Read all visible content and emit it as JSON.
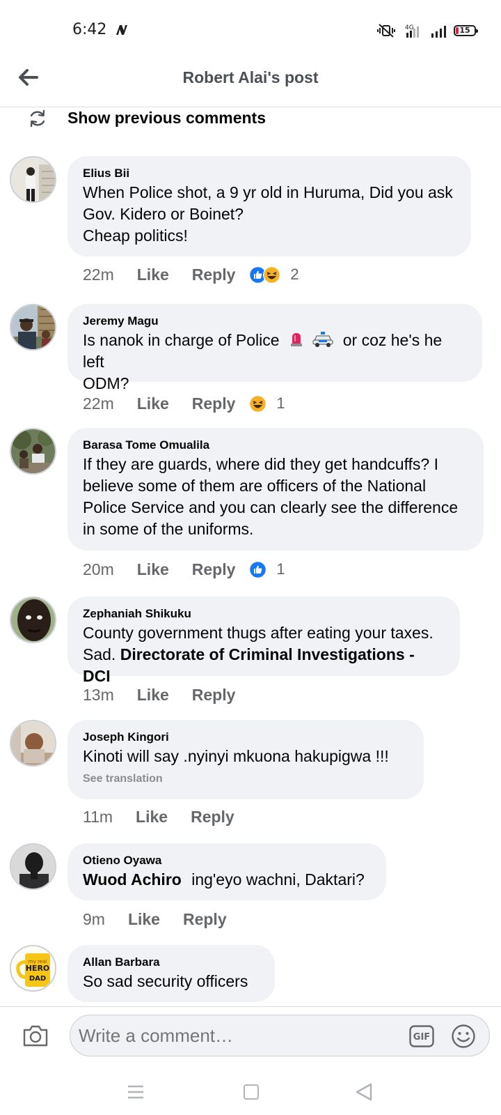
{
  "status_bar": {
    "time": "6:42",
    "battery": "15",
    "network": "4G"
  },
  "header": {
    "title": "Robert Alai's post"
  },
  "previous_comments": {
    "label": "Show previous comments"
  },
  "comments": [
    {
      "author": "Elius Bii",
      "lines": [
        "When Police shot, a 9 yr old in Huruma, Did you ask",
        "Gov. Kidero or Boinet?",
        "Cheap politics!"
      ],
      "time": "22m",
      "like": "Like",
      "reply": "Reply",
      "reactions": [
        "like",
        "haha"
      ],
      "reaction_count": "2"
    },
    {
      "author": "Jeremy Magu",
      "lines": [
        "Is nanok in charge of Police",
        "or coz he's he left",
        "ODM?"
      ],
      "emoji_in_text": [
        "police-light",
        "police-car"
      ],
      "time": "22m",
      "like": "Like",
      "reply": "Reply",
      "reactions": [
        "haha"
      ],
      "reaction_count": "1"
    },
    {
      "author": "Barasa Tome Omualila",
      "lines": [
        "If they are guards, where did they get handcuffs? I",
        "believe some of them are officers of the National",
        "Police Service and you can clearly see the difference",
        "in some of the uniforms."
      ],
      "time": "20m",
      "like": "Like",
      "reply": "Reply",
      "reactions": [
        "like"
      ],
      "reaction_count": "1"
    },
    {
      "author": "Zephaniah Shikuku",
      "lines": [
        "County government thugs after eating your taxes.",
        "Sad."
      ],
      "mention": "Directorate of Criminal Investigations - DCI",
      "time": "13m",
      "like": "Like",
      "reply": "Reply"
    },
    {
      "author": "Joseph Kingori",
      "lines": [
        "Kinoti will  say .nyinyi  mkuona hakupigwa !!!"
      ],
      "see_translation": "See translation",
      "time": "11m",
      "like": "Like",
      "reply": "Reply"
    },
    {
      "author": "Otieno Oyawa",
      "mention": "Wuod Achiro",
      "lines": [
        "ing'eyo wachni, Daktari?"
      ],
      "time": "9m",
      "like": "Like",
      "reply": "Reply"
    },
    {
      "author": "Allan Barbara",
      "lines": [
        "So sad security officers"
      ],
      "avatar_text": [
        "my real",
        "HERO",
        "DAD"
      ]
    }
  ],
  "composer": {
    "placeholder": "Write a comment…",
    "gif_label": "GIF"
  },
  "colors": {
    "like_blue": "#1877f2",
    "haha_yellow": "#f7b125",
    "bubble_gray": "#f0f2f5",
    "secondary_text": "#65676b"
  },
  "icons": [
    "back-arrow-icon",
    "refresh-icon",
    "camera-icon",
    "gif-icon",
    "emoji-icon",
    "menu-icon",
    "home-icon",
    "back-triangle-icon"
  ]
}
